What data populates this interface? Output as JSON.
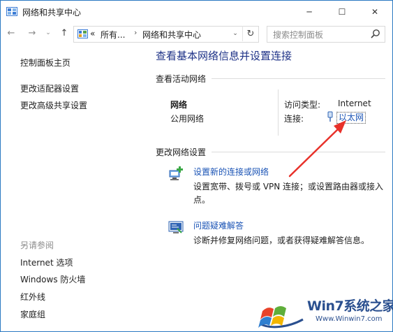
{
  "window": {
    "title": "网络和共享中心",
    "controls": {
      "minimize": "─",
      "maximize": "☐",
      "close": "✕"
    }
  },
  "address": {
    "back": "←",
    "forward": "→",
    "history": "⌄",
    "up": "↑",
    "prefix": "«",
    "segment1": "所有...",
    "separator": "›",
    "segment2": "网络和共享中心",
    "dropdown": "⌄",
    "refresh": "↻",
    "search_placeholder": "搜索控制面板"
  },
  "sidebar": {
    "links": [
      "控制面板主页",
      "更改适配器设置",
      "更改高级共享设置"
    ],
    "see_also_title": "另请参阅",
    "see_also": [
      "Internet 选项",
      "Windows 防火墙",
      "红外线",
      "家庭组"
    ]
  },
  "main": {
    "heading": "查看基本网络信息并设置连接",
    "active_title": "查看活动网络",
    "network_name": "网络",
    "network_category": "公用网络",
    "access_type_label": "访问类型:",
    "access_type_value": "Internet",
    "connections_label": "连接:",
    "connection_name": "以太网",
    "change_title": "更改网络设置",
    "tasks": [
      {
        "link": "设置新的连接或网络",
        "desc_line1": "设置宽带、拨号或 VPN 连接；或设置路由器或接入",
        "desc_line2": "点。"
      },
      {
        "link": "问题疑难解答",
        "desc_line1": "诊断并修复网络问题，或者获得疑难解答信息。"
      }
    ]
  },
  "watermark": {
    "brand": "Win7系统之家",
    "url": "Www.Winwin7.com"
  },
  "colors": {
    "heading": "#1e3287",
    "link": "#1a53b5",
    "arrow": "#e8312a",
    "frame": "#2b79c2"
  }
}
